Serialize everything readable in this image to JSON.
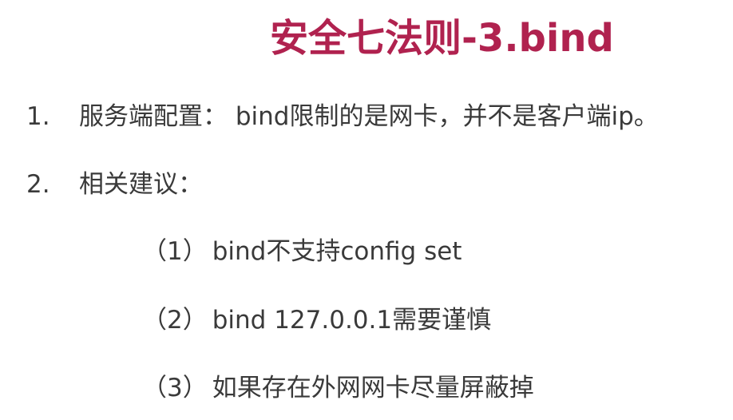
{
  "slide": {
    "title": "安全七法则-3.bind",
    "items": [
      {
        "number": "1.",
        "text": "服务端配置： bind限制的是网卡，并不是客户端ip。"
      },
      {
        "number": "2.",
        "text": "相关建议："
      }
    ],
    "sub_items": [
      {
        "marker": "（1）",
        "text": "bind不支持config set"
      },
      {
        "marker": "（2）",
        "text": "bind 127.0.0.1需要谨慎"
      },
      {
        "marker": "（3）",
        "text": "如果存在外网网卡尽量屏蔽掉"
      }
    ],
    "colors": {
      "title": "#b0224f",
      "body_text": "#3a3a3a",
      "background": "#ffffff"
    }
  }
}
